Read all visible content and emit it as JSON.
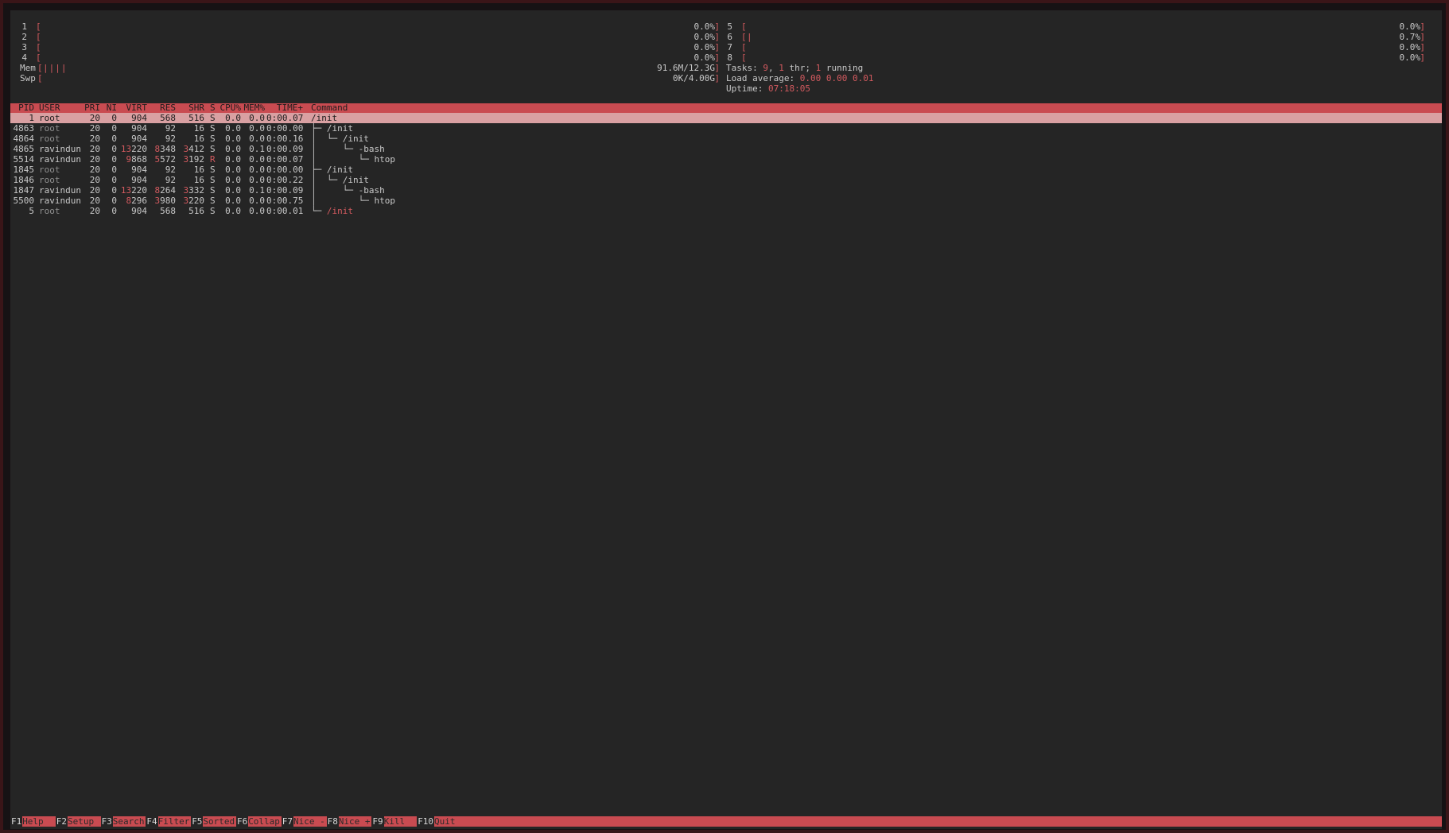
{
  "cpus_left": [
    {
      "num": "1",
      "bar": "",
      "value": "0.0%"
    },
    {
      "num": "2",
      "bar": "",
      "value": "0.0%"
    },
    {
      "num": "3",
      "bar": "",
      "value": "0.0%"
    },
    {
      "num": "4",
      "bar": "",
      "value": "0.0%"
    }
  ],
  "cpus_right": [
    {
      "num": "5",
      "bar": "",
      "value": "0.0%"
    },
    {
      "num": "6",
      "bar": "|",
      "value": "0.7%"
    },
    {
      "num": "7",
      "bar": "",
      "value": "0.0%"
    },
    {
      "num": "8",
      "bar": "",
      "value": "0.0%"
    }
  ],
  "mem": {
    "label": "Mem",
    "bar": "||||",
    "value": "91.6M/12.3G"
  },
  "swp": {
    "label": "Swp",
    "bar": "",
    "value": "0K/4.00G"
  },
  "tasks": {
    "label": "Tasks:",
    "count": "9",
    "sep1": ", ",
    "thr": "1",
    "thr_label": " thr; ",
    "running": "1",
    "running_label": " running"
  },
  "load": {
    "label": "Load average:",
    "v1": "0.00",
    "v2": "0.00",
    "v3": "0.01"
  },
  "uptime": {
    "label": "Uptime:",
    "value": "07:18:05"
  },
  "columns": [
    "PID",
    "USER",
    "PRI",
    "NI",
    "VIRT",
    "RES",
    "SHR",
    "S",
    "CPU%",
    "MEM%",
    "TIME+",
    "Command"
  ],
  "processes": [
    {
      "pid": "1",
      "user": "root",
      "pri": "20",
      "ni": "0",
      "virt_a": "",
      "virt_b": "904",
      "res_a": "",
      "res_b": "568",
      "shr_a": "",
      "shr_b": "516",
      "s": "S",
      "cpu": "0.0",
      "mem": "0.0",
      "time": "0:00.07",
      "tree": "",
      "cmd": "/init"
    },
    {
      "pid": "4863",
      "user": "root",
      "pri": "20",
      "ni": "0",
      "virt_a": "",
      "virt_b": "904",
      "res_a": "",
      "res_b": "92",
      "shr_a": "",
      "shr_b": "16",
      "s": "S",
      "cpu": "0.0",
      "mem": "0.0",
      "time": "0:00.00",
      "tree": "├─ ",
      "cmd": "/init"
    },
    {
      "pid": "4864",
      "user": "root",
      "pri": "20",
      "ni": "0",
      "virt_a": "",
      "virt_b": "904",
      "res_a": "",
      "res_b": "92",
      "shr_a": "",
      "shr_b": "16",
      "s": "S",
      "cpu": "0.0",
      "mem": "0.0",
      "time": "0:00.16",
      "tree": "│  └─ ",
      "cmd": "/init"
    },
    {
      "pid": "4865",
      "user": "ravindun",
      "pri": "20",
      "ni": "0",
      "virt_a": "13",
      "virt_b": "220",
      "res_a": "8",
      "res_b": "348",
      "shr_a": "3",
      "shr_b": "412",
      "s": "S",
      "cpu": "0.0",
      "mem": "0.1",
      "time": "0:00.09",
      "tree": "│     └─ ",
      "cmd": "-bash"
    },
    {
      "pid": "5514",
      "user": "ravindun",
      "pri": "20",
      "ni": "0",
      "virt_a": "9",
      "virt_b": "868",
      "res_a": "5",
      "res_b": "572",
      "shr_a": "3",
      "shr_b": "192",
      "s": "R",
      "cpu": "0.0",
      "mem": "0.0",
      "time": "0:00.07",
      "tree": "│        └─ ",
      "cmd": "htop"
    },
    {
      "pid": "1845",
      "user": "root",
      "pri": "20",
      "ni": "0",
      "virt_a": "",
      "virt_b": "904",
      "res_a": "",
      "res_b": "92",
      "shr_a": "",
      "shr_b": "16",
      "s": "S",
      "cpu": "0.0",
      "mem": "0.0",
      "time": "0:00.00",
      "tree": "├─ ",
      "cmd": "/init"
    },
    {
      "pid": "1846",
      "user": "root",
      "pri": "20",
      "ni": "0",
      "virt_a": "",
      "virt_b": "904",
      "res_a": "",
      "res_b": "92",
      "shr_a": "",
      "shr_b": "16",
      "s": "S",
      "cpu": "0.0",
      "mem": "0.0",
      "time": "0:00.22",
      "tree": "│  └─ ",
      "cmd": "/init"
    },
    {
      "pid": "1847",
      "user": "ravindun",
      "pri": "20",
      "ni": "0",
      "virt_a": "13",
      "virt_b": "220",
      "res_a": "8",
      "res_b": "264",
      "shr_a": "3",
      "shr_b": "332",
      "s": "S",
      "cpu": "0.0",
      "mem": "0.1",
      "time": "0:00.09",
      "tree": "│     └─ ",
      "cmd": "-bash"
    },
    {
      "pid": "5500",
      "user": "ravindun",
      "pri": "20",
      "ni": "0",
      "virt_a": "8",
      "virt_b": "296",
      "res_a": "3",
      "res_b": "980",
      "shr_a": "3",
      "shr_b": "220",
      "s": "S",
      "cpu": "0.0",
      "mem": "0.0",
      "time": "0:00.75",
      "tree": "│        └─ ",
      "cmd": "htop"
    },
    {
      "pid": "5",
      "user": "root",
      "pri": "20",
      "ni": "0",
      "virt_a": "",
      "virt_b": "904",
      "res_a": "",
      "res_b": "568",
      "shr_a": "",
      "shr_b": "516",
      "s": "S",
      "cpu": "0.0",
      "mem": "0.0",
      "time": "0:00.01",
      "tree": "└─ ",
      "cmd": "/init"
    }
  ],
  "footer": [
    {
      "key": "F1",
      "label": "Help"
    },
    {
      "key": "F2",
      "label": "Setup"
    },
    {
      "key": "F3",
      "label": "Search"
    },
    {
      "key": "F4",
      "label": "Filter"
    },
    {
      "key": "F5",
      "label": "Sorted"
    },
    {
      "key": "F6",
      "label": "Collap"
    },
    {
      "key": "F7",
      "label": "Nice -"
    },
    {
      "key": "F8",
      "label": "Nice +"
    },
    {
      "key": "F9",
      "label": "Kill"
    },
    {
      "key": "F10",
      "label": "Quit"
    }
  ],
  "colors": {
    "accent": "#c94b51",
    "background": "#252525",
    "selected_row": "#d9a0a2"
  }
}
